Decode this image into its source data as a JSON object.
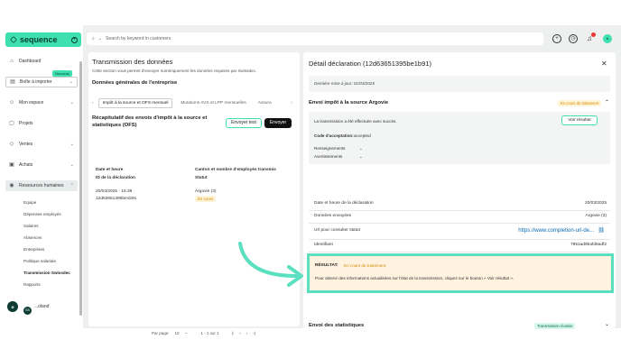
{
  "brand": {
    "name": "sequence"
  },
  "nav": [
    {
      "label": "Dashboard",
      "icon": "home-icon"
    },
    {
      "label": "Boîte à importer",
      "icon": "inbox-icon"
    },
    {
      "label": "Mon espace",
      "icon": "user-icon"
    },
    {
      "label": "Projets",
      "icon": "folder-icon"
    },
    {
      "label": "Ventes",
      "icon": "tag-icon"
    },
    {
      "label": "Achats",
      "icon": "cart-icon"
    },
    {
      "label": "Ressources humaines",
      "icon": "people-icon"
    }
  ],
  "badge_new": "Nouveau",
  "hr_items": [
    "Equipe",
    "Dépenses employés",
    "Salaires",
    "Absences",
    "Entreprises",
    "Politique salariale",
    "Transmission Swissdec",
    "Rapports"
  ],
  "user": {
    "name": "...oland",
    "initials": "SS"
  },
  "search": {
    "placeholder": "Search by keyword in customers"
  },
  "main": {
    "title": "Transmission des données",
    "desc": "Cette section vous permet d'envoyer numériquement les données requises par Swissdec.",
    "section": "Données générales de l'entreprise",
    "tabs": [
      "Impôt à la source et OFS mensuel",
      "Mutations AVS et LPP mensuelles",
      "Assura"
    ],
    "recap_title": "Récapitulatif des envois d'impôt à la source et statistiques (OFS)",
    "btn_test": "Envoyer test",
    "btn_send": "Envoyer",
    "col1a": "Date et heure",
    "col1b": "ID de la déclaration",
    "col2a": "Canton et nombre d'employés transmis",
    "col2b": "Statut",
    "row": {
      "date": "20/03/2025 - 15:39",
      "id": "12d63651395be1b91",
      "canton": "Argovie (3)",
      "status": "En cours"
    },
    "pager": {
      "per_page_label": "Par page:",
      "per_page": "10",
      "range": "1 - 1 sur 1"
    }
  },
  "detail": {
    "title": "Détail déclaration (12d63651395be1b91)",
    "updated": "Dernière mise à jour: 01/03/2025",
    "section1": "Envoi impôt à la source Argovie",
    "section1_status": "En cours de traitement",
    "transmitted": "La transmission a été effectuée avec succès.",
    "btn_result": "Voir résultat",
    "accept_label": "Code d'acceptation:",
    "accept_value": "accepted",
    "info": "Renseignements",
    "warnings": "Avertissements",
    "rows": [
      {
        "label": "Date et heure de la déclaration",
        "value": "20/03/2025"
      },
      {
        "label": "Données envoyées",
        "value": "Argovie (3)"
      },
      {
        "label": "Url pour consulter statut",
        "value": "https://www.completion-url-de..."
      },
      {
        "label": "Identifiant",
        "value": "7851ad9bafd8adf2"
      },
      {
        "label": "Mot de passe",
        "value": "••••••••"
      },
      {
        "label": "Validité",
        "value": "23/03/2025"
      }
    ],
    "result_label": "RÉSULTAT:",
    "result_status": "En cours de traitement",
    "result_msg": "Pour obtenir des informations actualisées sur l'état de la transmission, cliquez sur le bouton « Voir résultat ».",
    "section2": "Envoi des statistiques",
    "section2_status": "Transmission réussie"
  },
  "colors": {
    "accent": "#3ee0b0",
    "dark": "#0b3b33",
    "warn": "#d68b00"
  }
}
